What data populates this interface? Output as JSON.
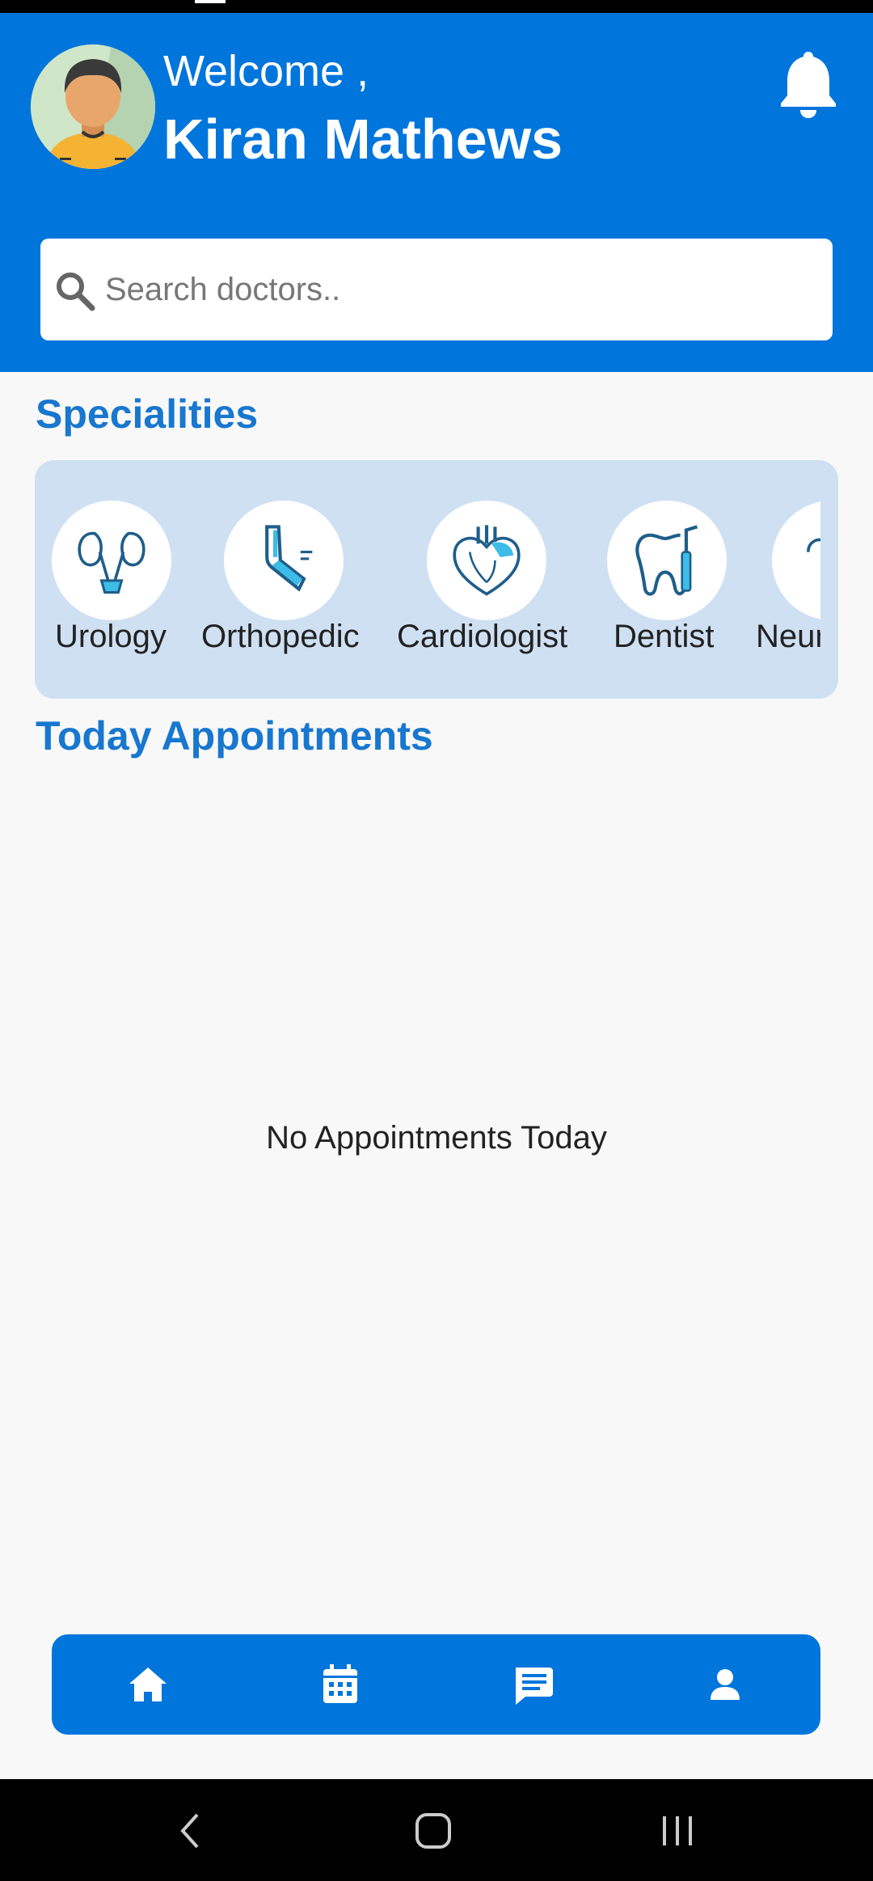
{
  "header": {
    "welcome_text": "Welcome ,",
    "user_name": "Kiran Mathews",
    "avatar_icon": "user-avatar-icon",
    "notification_icon": "bell-icon"
  },
  "search": {
    "placeholder": "Search doctors..",
    "value": "",
    "icon": "search-icon"
  },
  "specialities": {
    "title": "Specialities",
    "items": [
      {
        "label": "Urology",
        "icon": "kidney-icon"
      },
      {
        "label": "Orthopedic",
        "icon": "bone-joint-icon"
      },
      {
        "label": "Cardiologist",
        "icon": "heart-icon"
      },
      {
        "label": "Dentist",
        "icon": "tooth-icon"
      },
      {
        "label": "Neurologist",
        "icon": "brain-icon"
      }
    ]
  },
  "appointments": {
    "title": "Today Appointments",
    "empty_text": "No Appointments Today"
  },
  "bottom_nav": {
    "items": [
      {
        "name": "home",
        "icon": "home-icon"
      },
      {
        "name": "appointments",
        "icon": "calendar-icon"
      },
      {
        "name": "messages",
        "icon": "chat-icon"
      },
      {
        "name": "profile",
        "icon": "person-icon"
      }
    ]
  },
  "colors": {
    "primary": "#0075dc",
    "title_blue": "#1877cf",
    "panel_bg": "#cfe0f3",
    "background": "#f8f8f8"
  }
}
